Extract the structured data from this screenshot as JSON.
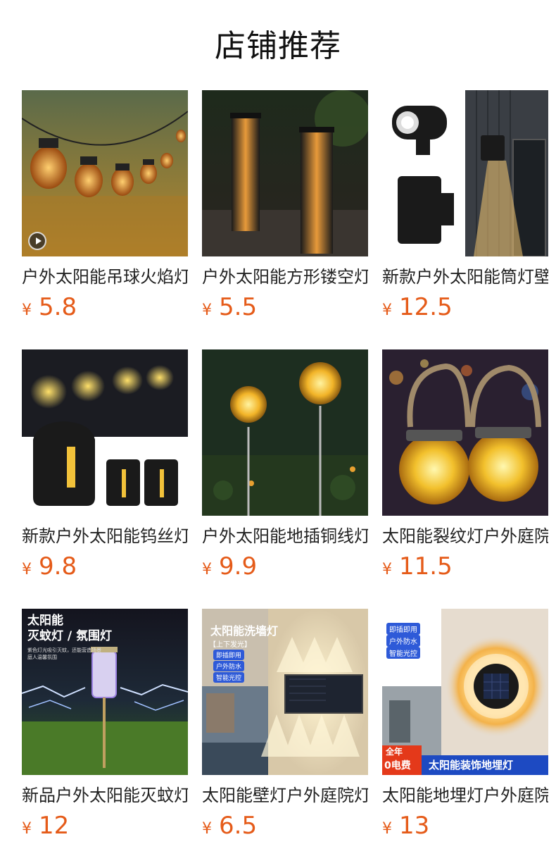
{
  "page": {
    "title": "店铺推荐"
  },
  "products": [
    {
      "name": "户外太阳能吊球火焰灯",
      "currency": "¥",
      "price": "5.8"
    },
    {
      "name": "户外太阳能方形镂空灯",
      "currency": "¥",
      "price": "5.5"
    },
    {
      "name": "新款户外太阳能筒灯壁灯",
      "currency": "¥",
      "price": "12.5"
    },
    {
      "name": "新款户外太阳能钨丝灯",
      "currency": "¥",
      "price": "9.8"
    },
    {
      "name": "户外太阳能地插铜线灯",
      "currency": "¥",
      "price": "9.9"
    },
    {
      "name": "太阳能裂纹灯户外庭院",
      "currency": "¥",
      "price": "11.5"
    },
    {
      "name": "新品户外太阳能灭蚊灯",
      "currency": "¥",
      "price": "12"
    },
    {
      "name": "太阳能壁灯户外庭院灯",
      "currency": "¥",
      "price": "6.5"
    },
    {
      "name": "太阳能地埋灯户外庭院",
      "currency": "¥",
      "price": "13"
    }
  ],
  "overlays": {
    "mosquito": {
      "line1": "太阳能",
      "line2": "灭蚊灯 / 氛围灯",
      "small1": "紫色灯光吸引灭蚊，还能营造场景",
      "small2": "庭人温馨氛围"
    },
    "wall": {
      "title": "太阳能洗墙灯",
      "sub": "【上下发光】",
      "tag1": "即插即用",
      "tag2": "户外防水",
      "tag3": "智能光控"
    },
    "ground": {
      "tag1": "即插即用",
      "tag2": "户外防水",
      "tag3": "智能光控",
      "year": "全年",
      "fee": "0电费",
      "banner": "太阳能装饰地埋灯"
    }
  },
  "colors": {
    "price": "#e55b19",
    "title": "#111111",
    "text": "#222222"
  }
}
